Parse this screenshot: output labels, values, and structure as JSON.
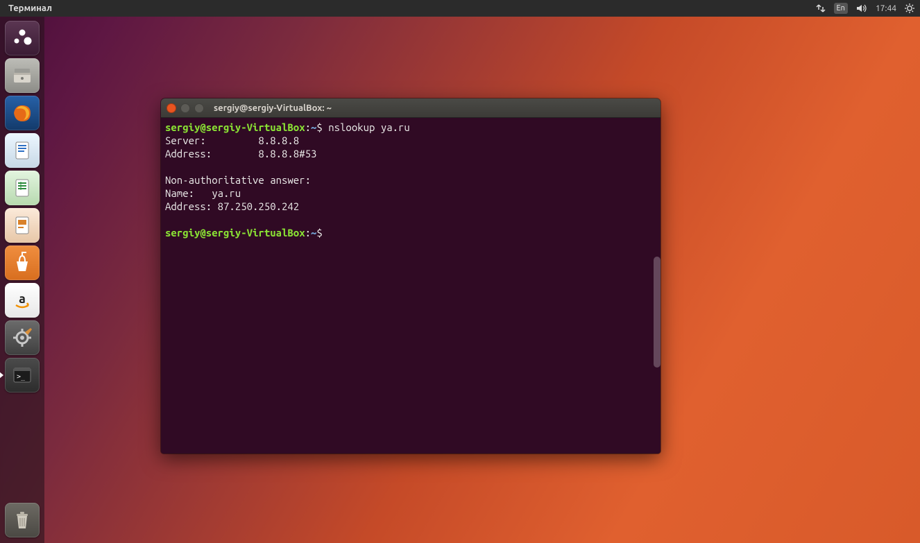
{
  "panel": {
    "app_title": "Терминал",
    "clock": "17:44",
    "lang": "En"
  },
  "launcher": {
    "items": [
      {
        "name": "dash-icon",
        "bg": "linear-gradient(#5b3652,#3a1b34)"
      },
      {
        "name": "files-icon",
        "bg": "linear-gradient(#bdbdb7,#8c8c87)"
      },
      {
        "name": "firefox-icon",
        "bg": "linear-gradient(#2290d6,#0a5aa0)"
      },
      {
        "name": "writer-icon",
        "bg": "linear-gradient(#edf7ff,#c7d8e6)"
      },
      {
        "name": "calc-icon",
        "bg": "linear-gradient(#e3f5df,#b7d9af)"
      },
      {
        "name": "impress-icon",
        "bg": "linear-gradient(#fbeada,#e7c7a8)"
      },
      {
        "name": "software-icon",
        "bg": "linear-gradient(#f08e3f,#d86e1f)"
      },
      {
        "name": "amazon-icon",
        "bg": "linear-gradient(#ffffff,#e7e7e7)"
      },
      {
        "name": "settings-icon",
        "bg": "linear-gradient(#6b6b6b,#3f3f3f)"
      },
      {
        "name": "terminal-icon",
        "bg": "linear-gradient(#4b4b4b,#2c2c2c)",
        "active": true
      }
    ],
    "trash_name": "trash-icon"
  },
  "terminal": {
    "title": "sergiy@sergiy-VirtualBox: ~",
    "prompt": {
      "user_host": "sergiy@sergiy-VirtualBox",
      "colon": ":",
      "path": "~",
      "dollar": "$"
    },
    "lines": {
      "cmd1": " nslookup ya.ru",
      "l1": "Server:         8.8.8.8",
      "l2": "Address:        8.8.8.8#53",
      "blank": "",
      "l3": "Non-authoritative answer:",
      "l4": "Name:   ya.ru",
      "l5": "Address: 87.250.250.242",
      "cmd2": " "
    }
  },
  "colors": {
    "terminal_bg": "#300a24",
    "green": "#8ae234",
    "blue": "#729fcf",
    "panel_bg": "#2b2b2b",
    "accent": "#e95420"
  }
}
